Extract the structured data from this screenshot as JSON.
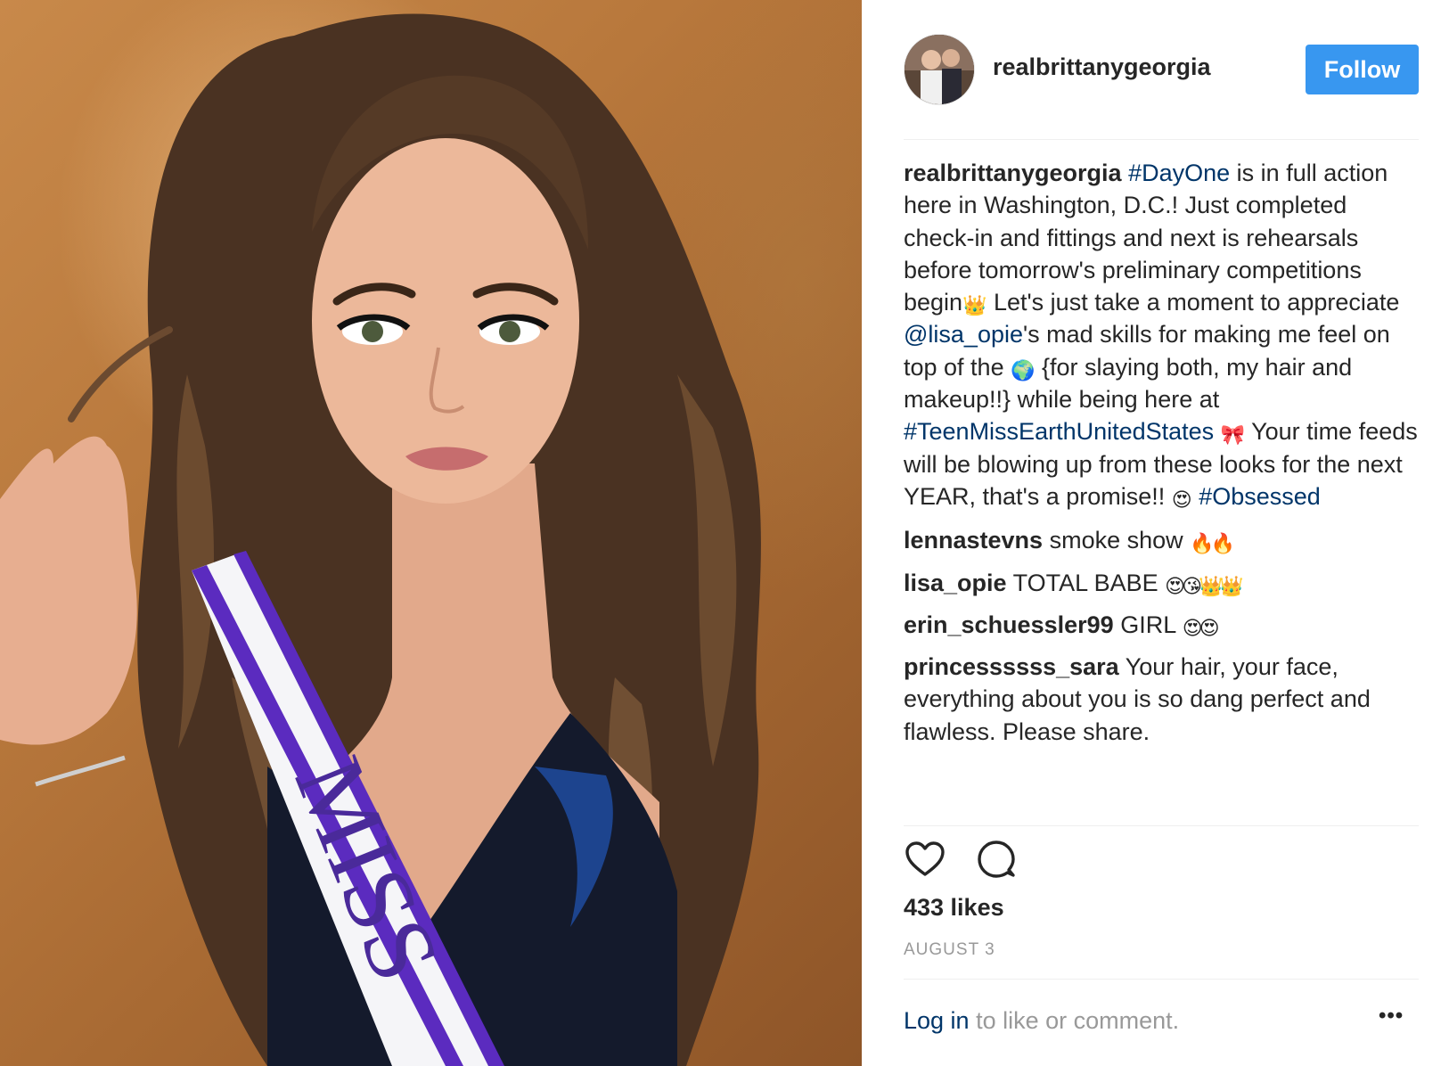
{
  "post": {
    "photo": {
      "sash_text": "MISS"
    },
    "author": {
      "username": "realbrittanygeorgia",
      "follow_label": "Follow"
    },
    "caption": {
      "user": "realbrittanygeorgia",
      "segments": [
        {
          "t": "#DayOne",
          "kind": "tag"
        },
        {
          "t": " is in full action here in Washington, D.C.! Just completed check-in and fittings and next is rehearsals before tomorrow's preliminary competitions begin",
          "kind": "text"
        },
        {
          "t": "👑",
          "kind": "emoji"
        },
        {
          "t": " Let's just take a moment to appreciate ",
          "kind": "text"
        },
        {
          "t": "@lisa_opie",
          "kind": "tag"
        },
        {
          "t": "'s mad skills for making me feel on top of the ",
          "kind": "text"
        },
        {
          "t": "🌍",
          "kind": "emoji"
        },
        {
          "t": " {for slaying both, my hair and makeup!!} while being here at ",
          "kind": "text"
        },
        {
          "t": "#TeenMissEarthUnitedStates",
          "kind": "tag"
        },
        {
          "t": " ",
          "kind": "text"
        },
        {
          "t": "🎀",
          "kind": "emoji"
        },
        {
          "t": " Your time feeds will be blowing up from these looks for the next YEAR, that's a promise!! ",
          "kind": "text"
        },
        {
          "t": "😍",
          "kind": "emoji"
        },
        {
          "t": " ",
          "kind": "text"
        },
        {
          "t": "#Obsessed",
          "kind": "tag"
        }
      ]
    },
    "comments": [
      {
        "user": "lennastevns",
        "text": "smoke show",
        "emoji": "🔥🔥"
      },
      {
        "user": "lisa_opie",
        "text": "TOTAL BABE",
        "emoji": "😍😘👑👑"
      },
      {
        "user": "erin_schuessler99",
        "text": "GIRL",
        "emoji": "😍😍"
      },
      {
        "user": "princessssss_sara",
        "text": "Your hair, your face, everything about you is so dang perfect and flawless. Please share.",
        "emoji": ""
      }
    ],
    "icons": {
      "like": "heart-outline-icon",
      "comment": "speech-bubble-icon",
      "more": "ellipsis-icon"
    },
    "likes_label": "433 likes",
    "date_label": "AUGUST 3",
    "login": {
      "link_label": "Log in",
      "rest_label": " to like or comment.",
      "more_label": "•••"
    },
    "colors": {
      "follow_button": "#3897f0",
      "link": "#003569",
      "muted": "#999999",
      "text": "#262626"
    }
  }
}
